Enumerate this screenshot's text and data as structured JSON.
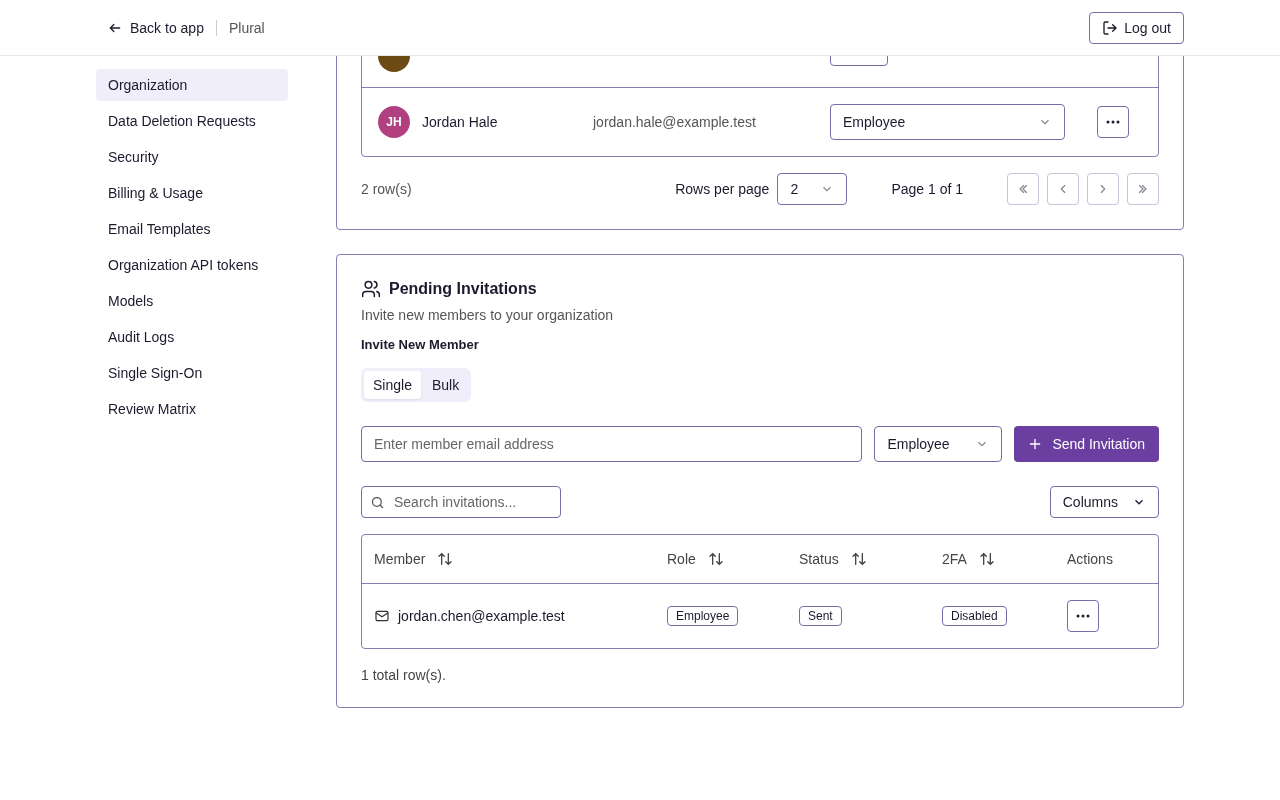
{
  "header": {
    "back": "Back to app",
    "app_name": "Plural",
    "logout": "Log out"
  },
  "sidebar": {
    "items": [
      {
        "label": "Organization",
        "selected": true
      },
      {
        "label": "Data Deletion Requests",
        "selected": false
      },
      {
        "label": "Security",
        "selected": false
      },
      {
        "label": "Billing & Usage",
        "selected": false
      },
      {
        "label": "Email Templates",
        "selected": false
      },
      {
        "label": "Organization API tokens",
        "selected": false
      },
      {
        "label": "Models",
        "selected": false
      },
      {
        "label": "Audit Logs",
        "selected": false
      },
      {
        "label": "Single Sign-On",
        "selected": false
      },
      {
        "label": "Review Matrix",
        "selected": false
      }
    ]
  },
  "members": {
    "rows": [
      {
        "color": "#6b4a14",
        "kind": "owner"
      },
      {
        "initials": "JH",
        "color": "#b0407f",
        "name": "Jordan Hale",
        "email": "jordan.hale@example.test",
        "kind": "editable",
        "role": "Employee"
      }
    ],
    "row_count": "2 row(s)",
    "rows_per_page_label": "Rows per page",
    "rows_per_page": "2",
    "page": "Page 1 of 1",
    "pager": [
      {
        "kind": "first",
        "disabled": true
      },
      {
        "kind": "prev",
        "disabled": true
      },
      {
        "kind": "next",
        "disabled": true
      },
      {
        "kind": "last",
        "disabled": true
      }
    ]
  },
  "invitations": {
    "title": "Pending Invitations",
    "subtitle": "Invite new members to your organization",
    "form_label": "Invite New Member",
    "modes": [
      {
        "label": "Single",
        "selected": true
      },
      {
        "label": "Bulk",
        "selected": false
      }
    ],
    "email_placeholder": "Enter member email address",
    "role": "Employee",
    "send": "Send Invitation",
    "search_placeholder": "Search invitations...",
    "columns_button": "Columns",
    "table": {
      "columns": [
        {
          "label": "Member",
          "sortable": true
        },
        {
          "label": "Role",
          "sortable": true
        },
        {
          "label": "Status",
          "sortable": true
        },
        {
          "label": "2FA",
          "sortable": true
        },
        {
          "label": "Actions",
          "sortable": false
        }
      ],
      "rows": [
        {
          "email": "jordan.chen@example.test",
          "role": "Employee",
          "status": "Sent",
          "twofa": "Disabled"
        }
      ]
    },
    "total": "1 total row(s)."
  }
}
